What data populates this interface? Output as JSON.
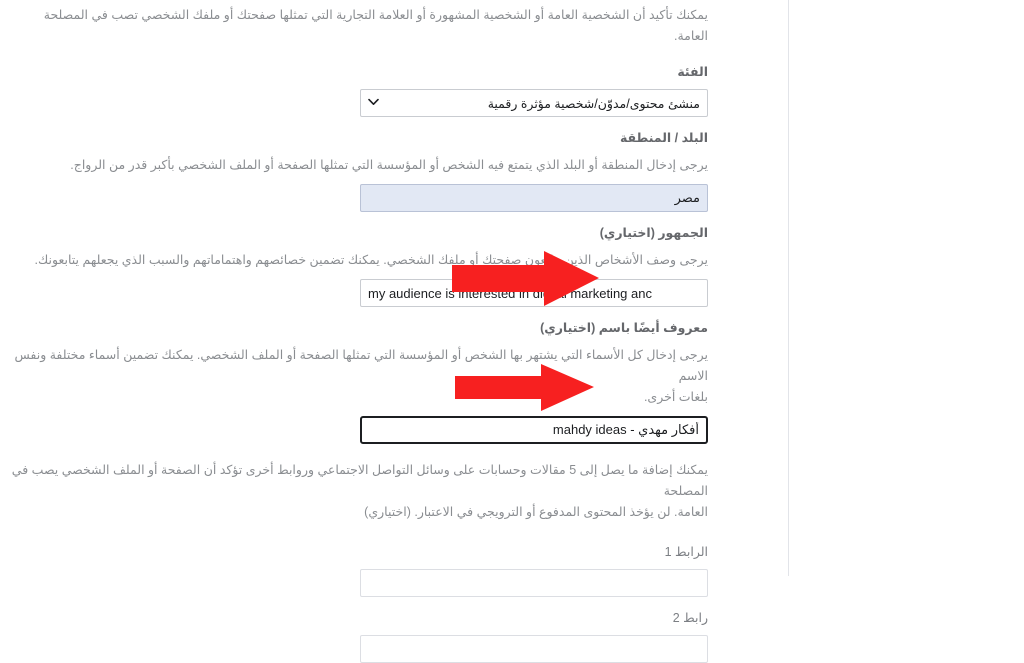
{
  "meta": {
    "language_direction": "rtl",
    "accent_annotation_color": "#f72020",
    "highlight_field_bg": "#e2e8f4"
  },
  "intro": {
    "note": "يمكنك تأكيد أن الشخصية العامة أو الشخصية المشهورة أو العلامة التجارية التي تمثلها صفحتك أو ملفك الشخصي تصب في المصلحة العامة."
  },
  "fields": {
    "category": {
      "label": "الفئة",
      "selected_value": "منشئ محتوى/مدوّن/شخصية مؤثرة رقمية",
      "chevron_icon": "chevron-down-icon"
    },
    "country": {
      "label": "البلد / المنطقة",
      "help": "يرجى إدخال المنطقة أو البلد الذي يتمتع فيه الشخص أو المؤسسة التي تمثلها الصفحة أو الملف الشخصي بأكبر قدر من الرواج.",
      "value": "مصر",
      "placeholder": ""
    },
    "audience": {
      "label": "الجمهور (اختياري)",
      "help": "يرجى وصف الأشخاص الذين يتابعون صفحتك أو ملفك الشخصي. يمكنك تضمين خصائصهم واهتماماتهم والسبب الذي يجعلهم يتابعونك.",
      "value": "my audience is interested in digital marketing anc",
      "placeholder": ""
    },
    "also_known_as": {
      "label": "معروف أيضًا باسم (اختياري)",
      "help_line_1": "يرجى إدخال كل الأسماء التي يشتهر بها الشخص أو المؤسسة التي تمثلها الصفحة أو الملف الشخصي. يمكنك تضمين أسماء مختلفة ونفس الاسم",
      "help_line_2": "بلغات أخرى.",
      "value": "أفكار مهدي - mahdy ideas",
      "placeholder": ""
    },
    "links_note_line_1": "يمكنك إضافة ما يصل إلى 5 مقالات وحسابات على وسائل التواصل الاجتماعي وروابط أخرى تؤكد أن الصفحة أو الملف الشخصي يصب في المصلحة",
    "links_note_line_2": "العامة. لن يؤخذ المحتوى المدفوع أو الترويجي في الاعتبار. (اختياري)",
    "link1": {
      "label": "الرابط 1",
      "value": "",
      "placeholder": ""
    },
    "link2": {
      "label": "رابط 2",
      "value": "",
      "placeholder": ""
    }
  },
  "annotations": {
    "arrow_audience": "arrow-right-icon",
    "arrow_also_known_as": "arrow-right-icon"
  }
}
